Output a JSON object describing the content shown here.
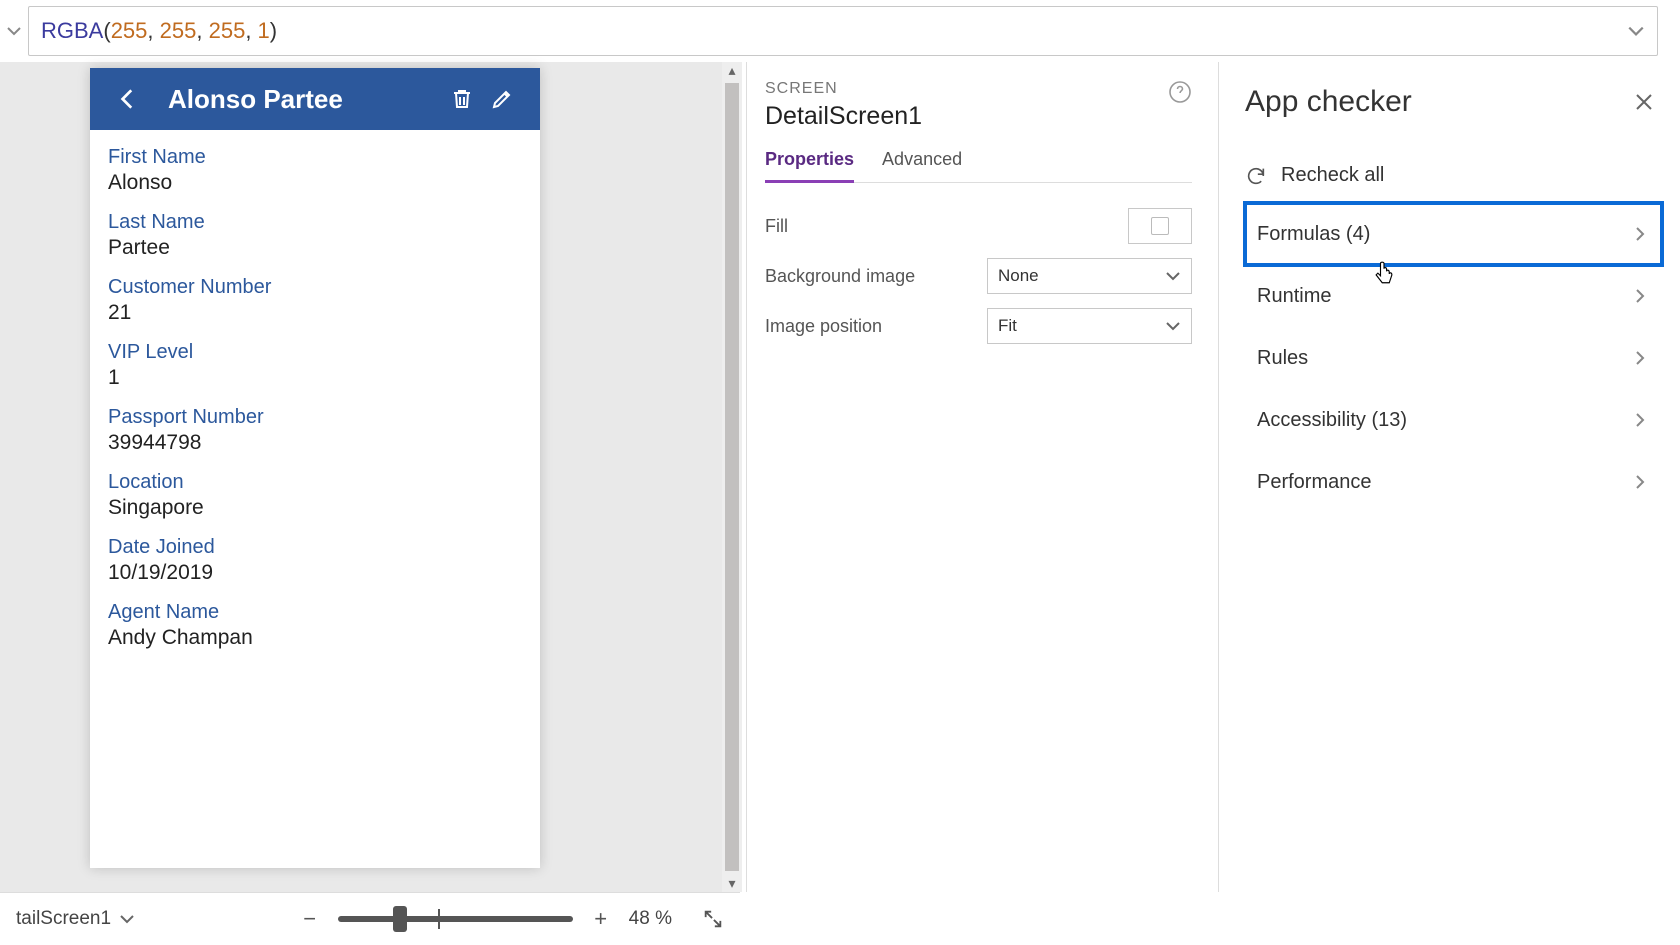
{
  "formula": {
    "fn": "RGBA",
    "args": [
      "255",
      "255",
      "255",
      "1"
    ]
  },
  "canvas": {
    "header_title": "Alonso Partee",
    "fields": [
      {
        "label": "First Name",
        "value": "Alonso"
      },
      {
        "label": "Last Name",
        "value": "Partee"
      },
      {
        "label": "Customer Number",
        "value": "21"
      },
      {
        "label": "VIP Level",
        "value": "1"
      },
      {
        "label": "Passport Number",
        "value": "39944798"
      },
      {
        "label": "Location",
        "value": "Singapore"
      },
      {
        "label": "Date Joined",
        "value": "10/19/2019"
      },
      {
        "label": "Agent Name",
        "value": "Andy Champan"
      }
    ]
  },
  "props": {
    "type_label": "SCREEN",
    "name": "DetailScreen1",
    "tabs": {
      "properties": "Properties",
      "advanced": "Advanced"
    },
    "rows": {
      "fill": "Fill",
      "bg_image": "Background image",
      "bg_image_value": "None",
      "img_pos": "Image position",
      "img_pos_value": "Fit"
    }
  },
  "checker": {
    "title": "App checker",
    "recheck": "Recheck all",
    "items": [
      {
        "label": "Formulas (4)",
        "highlight": true
      },
      {
        "label": "Runtime"
      },
      {
        "label": "Rules"
      },
      {
        "label": "Accessibility (13)"
      },
      {
        "label": "Performance"
      }
    ]
  },
  "footer": {
    "breadcrumb": "tailScreen1",
    "zoom_value": "48",
    "zoom_unit": "%"
  }
}
